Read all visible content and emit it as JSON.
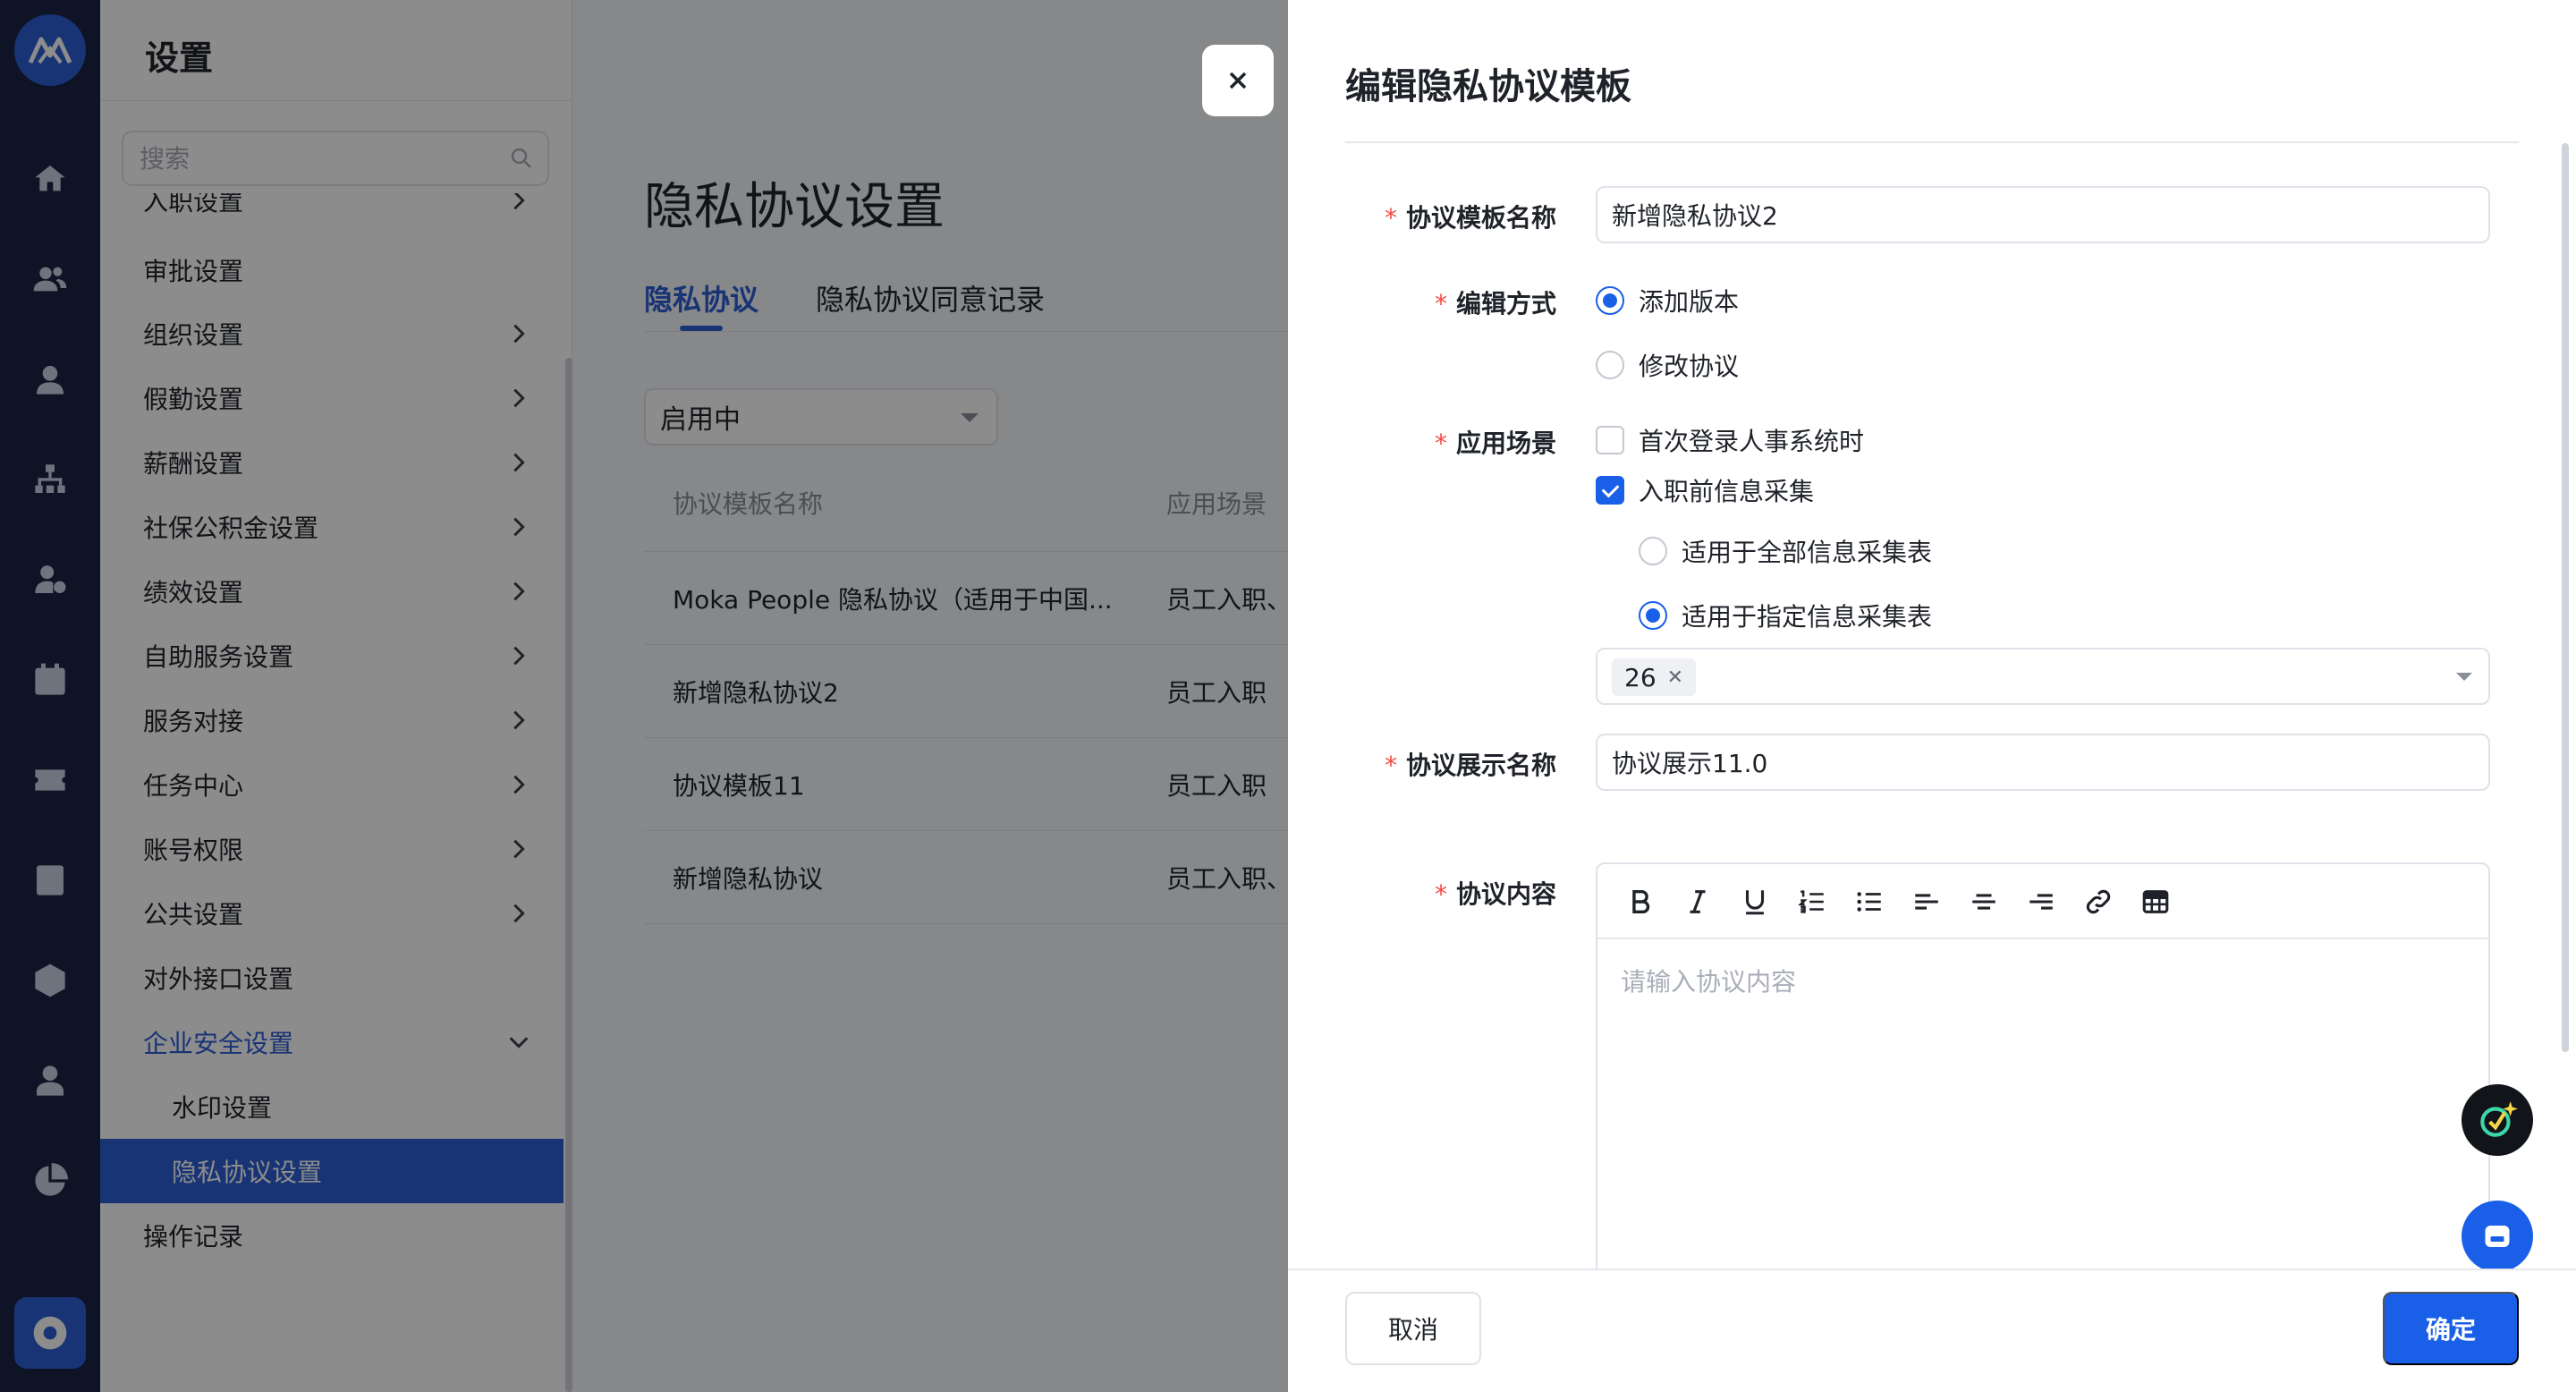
{
  "colors": {
    "brand": "#2c5fd6",
    "primary_button": "#1a5fe8",
    "required": "#f54a45",
    "rail_bg": "#1b2646"
  },
  "rail": {
    "icons": [
      "home-icon",
      "users-icon",
      "person-icon",
      "org-chart-icon",
      "person-settings-icon",
      "calendar-icon",
      "yuan-icon",
      "report-icon",
      "cube-icon",
      "profile-icon",
      "pie-chart-icon",
      "settings-gear-icon"
    ]
  },
  "settings": {
    "title": "设置",
    "search_placeholder": "搜索",
    "menu": [
      {
        "label": "入职设置",
        "chevron": true
      },
      {
        "label": "审批设置",
        "chevron": false
      },
      {
        "label": "组织设置",
        "chevron": true
      },
      {
        "label": "假勤设置",
        "chevron": true
      },
      {
        "label": "薪酬设置",
        "chevron": true
      },
      {
        "label": "社保公积金设置",
        "chevron": true
      },
      {
        "label": "绩效设置",
        "chevron": true
      },
      {
        "label": "自助服务设置",
        "chevron": true
      },
      {
        "label": "服务对接",
        "chevron": true
      },
      {
        "label": "任务中心",
        "chevron": true
      },
      {
        "label": "账号权限",
        "chevron": true
      },
      {
        "label": "公共设置",
        "chevron": true
      },
      {
        "label": "对外接口设置",
        "chevron": false
      },
      {
        "label": "企业安全设置",
        "chevron": true,
        "expanded": true
      },
      {
        "label": "水印设置",
        "sub": true
      },
      {
        "label": "隐私协议设置",
        "sub": true,
        "active": true
      },
      {
        "label": "操作记录",
        "chevron": false
      }
    ]
  },
  "main": {
    "title": "隐私协议设置",
    "tabs": [
      "隐私协议",
      "隐私协议同意记录"
    ],
    "active_tab": 0,
    "status_filter": "启用中",
    "columns": [
      "协议模板名称",
      "应用场景"
    ],
    "rows": [
      [
        "Moka People 隐私协议（适用于中国...",
        "员工入职、"
      ],
      [
        "新增隐私协议2",
        "员工入职"
      ],
      [
        "协议模板11",
        "员工入职"
      ],
      [
        "新增隐私协议",
        "员工入职、"
      ]
    ]
  },
  "drawer": {
    "close_label": "×",
    "title": "编辑隐私协议模板",
    "fields": {
      "template_name": {
        "label": "协议模板名称",
        "value": "新增隐私协议2"
      },
      "edit_mode": {
        "label": "编辑方式",
        "options": [
          "添加版本",
          "修改协议"
        ],
        "selected": 0
      },
      "scene": {
        "label": "应用场景",
        "options": [
          {
            "label": "首次登录人事系统时",
            "checked": false
          },
          {
            "label": "入职前信息采集",
            "checked": true
          }
        ],
        "sub_options": [
          "适用于全部信息采集表",
          "适用于指定信息采集表"
        ],
        "sub_selected": 1,
        "selected_tags": [
          "26"
        ]
      },
      "display_name": {
        "label": "协议展示名称",
        "value": "协议展示11.0"
      },
      "content": {
        "label": "协议内容",
        "placeholder": "请输入协议内容",
        "toolbar": [
          "bold-icon",
          "italic-icon",
          "underline-icon",
          "ordered-list-icon",
          "bullet-list-icon",
          "align-left-icon",
          "align-center-icon",
          "align-right-icon",
          "link-icon",
          "table-icon"
        ]
      }
    },
    "footer": {
      "cancel": "取消",
      "confirm": "确定"
    }
  }
}
